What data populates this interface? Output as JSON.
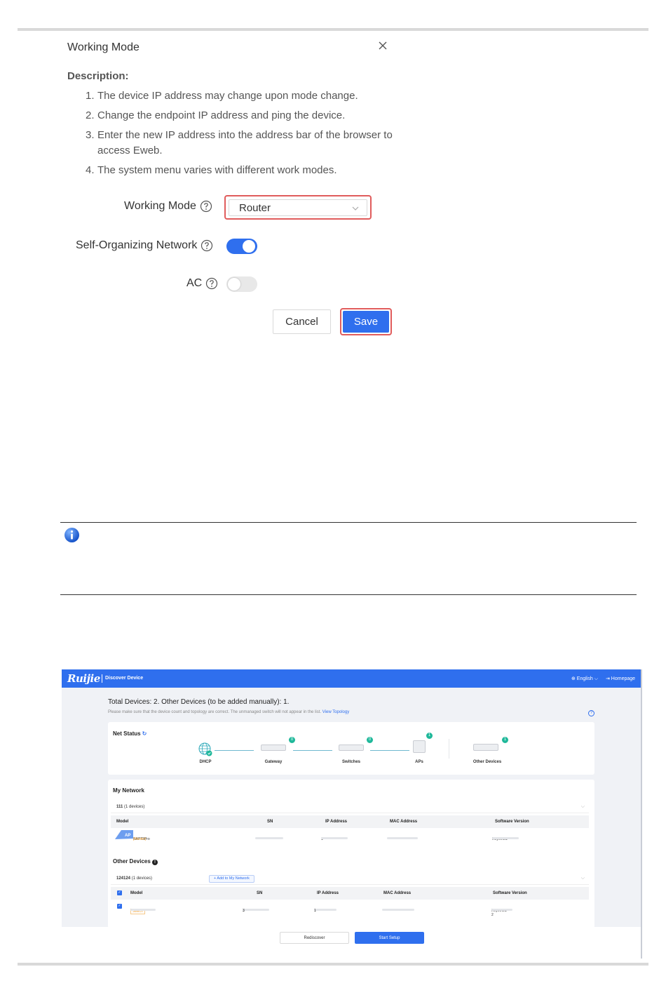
{
  "dialog": {
    "title": "Working Mode",
    "description_title": "Description:",
    "items": [
      {
        "num": "1.",
        "text": "The device IP address may change upon mode change."
      },
      {
        "num": "2.",
        "text": "Change the endpoint IP address and ping the device."
      },
      {
        "num": "3.",
        "text": "Enter the new IP address into the address bar of the browser to access Eweb."
      },
      {
        "num": "4.",
        "text": "The system menu varies with different work modes."
      }
    ],
    "working_mode_label": "Working Mode",
    "working_mode_value": "Router",
    "self_org_label": "Self-Organizing Network",
    "self_org_enabled": true,
    "ac_label": "AC",
    "ac_enabled": false,
    "cancel_label": "Cancel",
    "save_label": "Save",
    "highlight_color": "#e05c5c",
    "accent_color": "#2f6fee"
  },
  "icons": {
    "close": "close-icon",
    "help": "question-circle-icon",
    "info": "info-icon",
    "dropdown": "chevron-down-icon"
  },
  "discover": {
    "logo": "Ruijie",
    "title": "Discover Device",
    "language": "⊕ English ⌵",
    "homepage": "⇥ Homepage",
    "summary": "Total Devices: 2. Other Devices (to be added manually): 1.",
    "hint": "Please make sure that the device count and topology are correct. The unmanaged switch will not appear in the list.",
    "view_topology": "View Topology",
    "net_status": "Net Status",
    "topology": [
      {
        "label": "DHCP"
      },
      {
        "label": "Gateway",
        "count": "0"
      },
      {
        "label": "Switches",
        "count": "0"
      },
      {
        "label": "APs",
        "count": "1"
      },
      {
        "label": "Other Devices",
        "count": "1"
      }
    ],
    "my_network": {
      "title": "My Network",
      "group_name": "111",
      "group_count": "(1 devices)",
      "columns": [
        "Model",
        "SN",
        "IP Address",
        "MAC Address",
        "Software Version"
      ],
      "row": {
        "type": "AP",
        "model": "RAP73Pro",
        "role": "[Master]",
        "ip_prefix": "1",
        "version": "ReyeeOS"
      }
    },
    "other_devices": {
      "title": "Other Devices",
      "group_name": "124124",
      "group_count": "(1 devices)",
      "add_label": "+ Add to My Network",
      "columns": [
        "Model",
        "SN",
        "IP Address",
        "MAC Address",
        "Software Version"
      ],
      "row": {
        "type": "Switch",
        "model_prefix": "*",
        "sn_prefix": "1",
        "sn_suffix": "3",
        "ip_prefix": "1",
        "ip_suffix": "1",
        "version": "ReyeeOS 2"
      }
    },
    "rediscover_label": "Rediscover",
    "start_setup_label": "Start Setup"
  }
}
